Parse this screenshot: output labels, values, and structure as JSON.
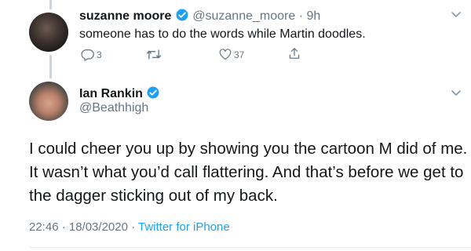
{
  "reply": {
    "name": "suzanne moore",
    "handle": "@suzanne_moore",
    "separator": "·",
    "time": "9h",
    "text": "someone has to do the words while Martin doodles.",
    "replies": "3",
    "retweets": "",
    "likes": "37"
  },
  "tweet": {
    "name": "Ian Rankin",
    "handle": "@Beathhigh",
    "lines": [
      "I could cheer you up by showing you the cartoon M did of me.",
      "It wasn’t what you’d call flattering. And that’s before we get to",
      "the dagger sticking out of my back."
    ],
    "time": "22:46 · 18/03/2020 · ",
    "source": "Twitter for iPhone"
  },
  "colors": {
    "verified": "#1da1f2",
    "muted": "#657786",
    "link": "#1da1f2"
  }
}
